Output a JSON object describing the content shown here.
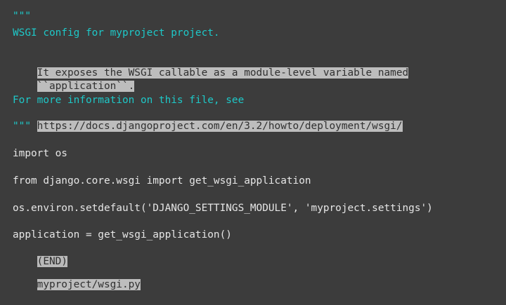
{
  "pager": {
    "lines": [
      {
        "text": "\"\"\"",
        "style": "cyan"
      },
      {
        "text": "WSGI config for myproject project.",
        "style": "cyan"
      },
      {
        "text": "It exposes the WSGI callable as a module-level variable named",
        "style": "highlight"
      },
      {
        "text": "``application``.",
        "style": "highlight"
      },
      {
        "text": "For more information on this file, see",
        "style": "cyan"
      },
      {
        "text": "https://docs.djangoproject.com/en/3.2/howto/deployment/wsgi/",
        "style": "highlight"
      },
      {
        "text": "\"\"\"",
        "style": "cyan"
      },
      {
        "text": "import os",
        "style": "plain"
      },
      {
        "text": "from django.core.wsgi import get_wsgi_application",
        "style": "plain"
      },
      {
        "text": "os.environ.setdefault('DJANGO_SETTINGS_MODULE', 'myproject.settings')",
        "style": "plain"
      },
      {
        "text": "application = get_wsgi_application()",
        "style": "plain"
      }
    ],
    "end_marker": "(END)",
    "filename": "myproject/wsgi.py"
  }
}
